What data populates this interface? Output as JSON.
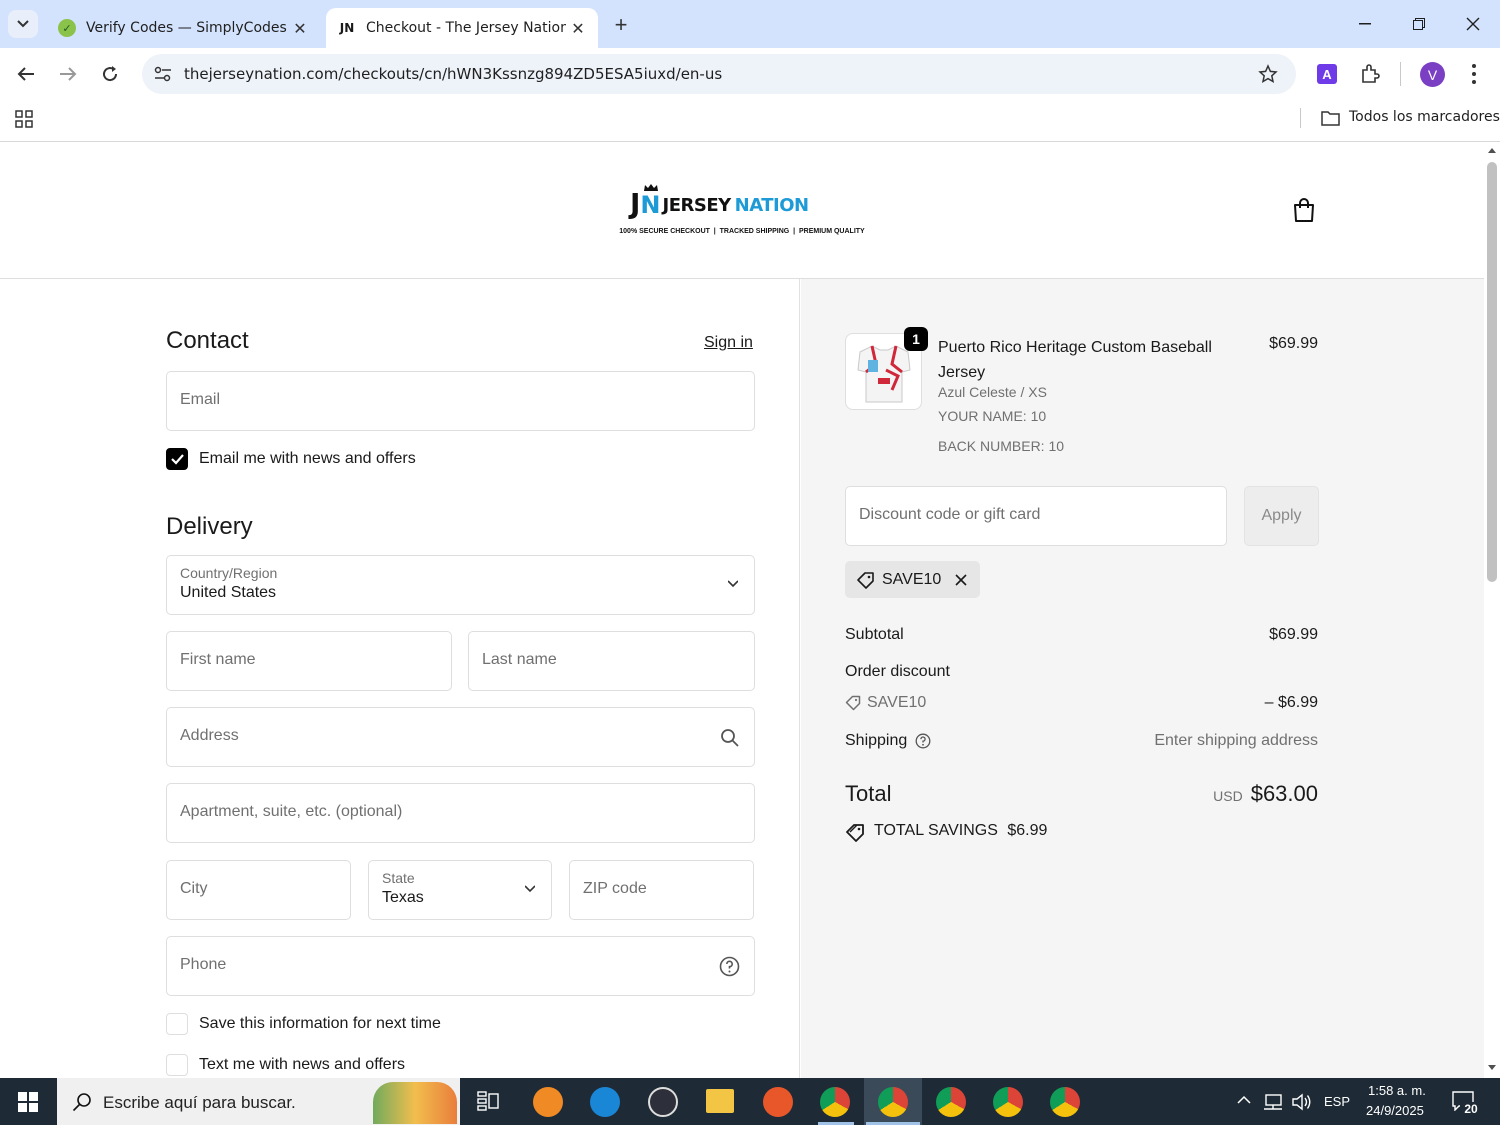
{
  "browser": {
    "tabs": [
      {
        "title": "Verify Codes — SimplyCodes",
        "active": false
      },
      {
        "title": "Checkout - The Jersey Nation",
        "active": true
      }
    ],
    "url": "thejerseynation.com/checkouts/cn/hWN3Kssnzg894ZD5ESA5iuxd/en-us",
    "bookmarks_label": "Todos los marcadores",
    "profile_initial": "V",
    "extension_initial": "A"
  },
  "header": {
    "logo_left": "J",
    "logo_n": "N",
    "logo_word1": "JERSEY",
    "logo_word2": "NATION",
    "tagline": "100% SECURE CHECKOUT  |  TRACKED SHIPPING  |  PREMIUM QUALITY"
  },
  "contact": {
    "title": "Contact",
    "sign_in": "Sign in",
    "email_placeholder": "Email",
    "newsletter_label": "Email me with news and offers",
    "newsletter_checked": true
  },
  "delivery": {
    "title": "Delivery",
    "country_label": "Country/Region",
    "country_value": "United States",
    "first_name": "First name",
    "last_name": "Last name",
    "address": "Address",
    "apartment": "Apartment, suite, etc. (optional)",
    "city": "City",
    "state_label": "State",
    "state_value": "Texas",
    "zip": "ZIP code",
    "phone": "Phone",
    "save_info": "Save this information for next time",
    "text_me": "Text me with news and offers"
  },
  "summary": {
    "product": {
      "name_line1": "Puerto Rico Heritage Custom Baseball",
      "name_line2": "Jersey",
      "variant": "Azul Celeste / XS",
      "your_name": "YOUR NAME: 10",
      "back_number": "BACK NUMBER: 10",
      "price": "$69.99",
      "quantity": "1"
    },
    "discount_placeholder": "Discount code or gift card",
    "apply_label": "Apply",
    "applied_code": "SAVE10",
    "subtotal_label": "Subtotal",
    "subtotal_value": "$69.99",
    "order_discount_label": "Order discount",
    "discount_code": "SAVE10",
    "discount_value": "– $6.99",
    "shipping_label": "Shipping",
    "shipping_value": "Enter shipping address",
    "total_label": "Total",
    "currency": "USD",
    "total_value": "$63.00",
    "savings_label": "TOTAL SAVINGS",
    "savings_value": "$6.99"
  },
  "taskbar": {
    "search_placeholder": "Escribe aquí para buscar.",
    "language": "ESP",
    "time": "1:58 a. m.",
    "date": "24/9/2025",
    "notifications": "20"
  }
}
